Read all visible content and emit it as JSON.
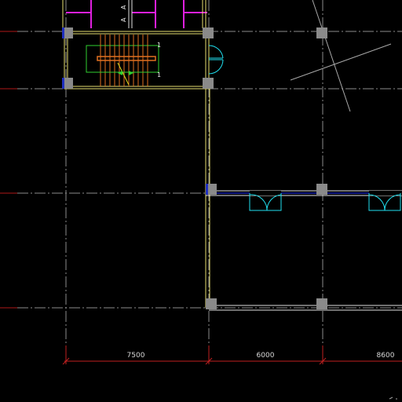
{
  "drawing": {
    "background": "#000000",
    "colors": {
      "axis_gray": "#8c8c8c",
      "axis_red": "#b01818",
      "axis_blue": "#2020c0",
      "wall_yellow": "#e8e070",
      "wall_white": "#e0e0e0",
      "door_cyan": "#20e0f0",
      "partition_magenta": "#e020e0",
      "column_gray": "#8a8a8a",
      "stair_orange": "#e07020",
      "stair_green": "#30d030",
      "dim_red": "#c02020",
      "blue_line": "#2030ff"
    }
  },
  "dimensions": {
    "spans": [
      {
        "label": "7500"
      },
      {
        "label": "6000"
      },
      {
        "label": "8600"
      }
    ]
  },
  "stair_marks": {
    "upper_mark": "1",
    "lower_mark": "1"
  },
  "room_marks": {
    "left_mark": "A",
    "right_mark": "A"
  }
}
